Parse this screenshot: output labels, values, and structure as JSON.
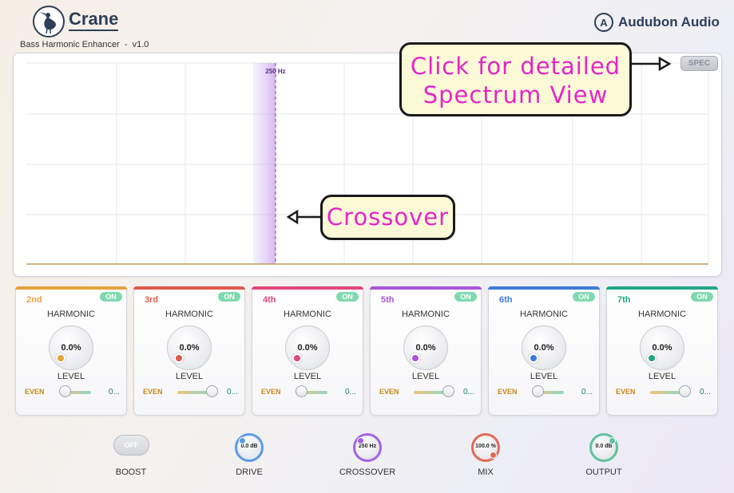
{
  "header": {
    "title": "Crane",
    "subtitle": "Bass Harmonic Enhancer  -  v1.0",
    "logo_icon": "heron-icon",
    "brand_mark": "A",
    "brand": "Audubon Audio"
  },
  "display": {
    "crossover_label": "250 Hz",
    "spec_button": "SPEC",
    "crossover_color": "#9b5bd6"
  },
  "annotations": {
    "spectrum_line1": "Click for detailed",
    "spectrum_line2": "Spectrum View",
    "crossover": "Crossover",
    "text_color": "#e624c9"
  },
  "harmonics": [
    {
      "name": "2nd",
      "on": "ON",
      "label": "HARMONIC",
      "value": "0.0%",
      "level_label": "LEVEL",
      "even_label": "EVEN",
      "odd_value": "0...",
      "color": "#e6a23c",
      "even_odd_position": 0.1
    },
    {
      "name": "3rd",
      "on": "ON",
      "label": "HARMONIC",
      "value": "0.0%",
      "level_label": "LEVEL",
      "even_label": "EVEN",
      "odd_value": "0...",
      "color": "#e05a4a",
      "even_odd_position": 0.9
    },
    {
      "name": "4th",
      "on": "ON",
      "label": "HARMONIC",
      "value": "0.0%",
      "level_label": "LEVEL",
      "even_label": "EVEN",
      "odd_value": "0...",
      "color": "#e0467c",
      "even_odd_position": 0.1
    },
    {
      "name": "5th",
      "on": "ON",
      "label": "HARMONIC",
      "value": "0.0%",
      "level_label": "LEVEL",
      "even_label": "EVEN",
      "odd_value": "0...",
      "color": "#a855d8",
      "even_odd_position": 0.9
    },
    {
      "name": "6th",
      "on": "ON",
      "label": "HARMONIC",
      "value": "0.0%",
      "level_label": "LEVEL",
      "even_label": "EVEN",
      "odd_value": "0...",
      "color": "#3d7bd9",
      "even_odd_position": 0.1
    },
    {
      "name": "7th",
      "on": "ON",
      "label": "HARMONIC",
      "value": "0.0%",
      "level_label": "LEVEL",
      "even_label": "EVEN",
      "odd_value": "0...",
      "color": "#22a585",
      "even_odd_position": 0.9
    }
  ],
  "controls": {
    "boost": {
      "state": "OFF",
      "label": "BOOST"
    },
    "drive": {
      "value": "0.0 dB",
      "label": "DRIVE",
      "color": "#5b9be0"
    },
    "crossover": {
      "value": "250 Hz",
      "label": "CROSSOVER",
      "color": "#a463e0"
    },
    "mix": {
      "value": "100.0 %",
      "label": "MIX",
      "color": "#e06a55"
    },
    "output": {
      "value": "0.0 dB",
      "label": "OUTPUT",
      "color": "#5fc39a"
    }
  }
}
